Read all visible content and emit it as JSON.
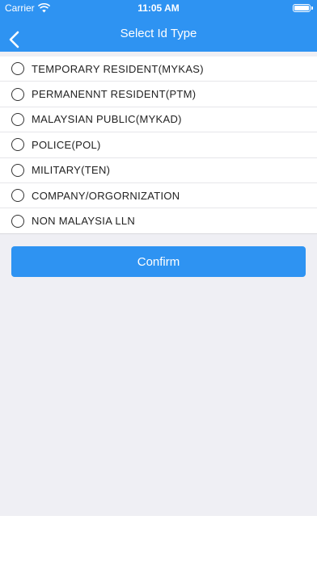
{
  "status_bar": {
    "carrier": "Carrier",
    "time": "11:05 AM"
  },
  "nav": {
    "title": "Select Id Type",
    "back_icon": "chevron-left-icon"
  },
  "options": [
    {
      "label": "TEMPORARY RESIDENT(MYKAS)",
      "selected": false
    },
    {
      "label": "PERMANENNT RESIDENT(PTM)",
      "selected": false
    },
    {
      "label": "MALAYSIAN PUBLIC(MYKAD)",
      "selected": false
    },
    {
      "label": "POLICE(POL)",
      "selected": false
    },
    {
      "label": "MILITARY(TEN)",
      "selected": false
    },
    {
      "label": "COMPANY/ORGORNIZATION",
      "selected": false
    },
    {
      "label": "NON MALAYSIA LLN",
      "selected": false
    }
  ],
  "confirm": {
    "label": "Confirm"
  },
  "colors": {
    "accent": "#2e93f2",
    "background": "#efeff4"
  }
}
